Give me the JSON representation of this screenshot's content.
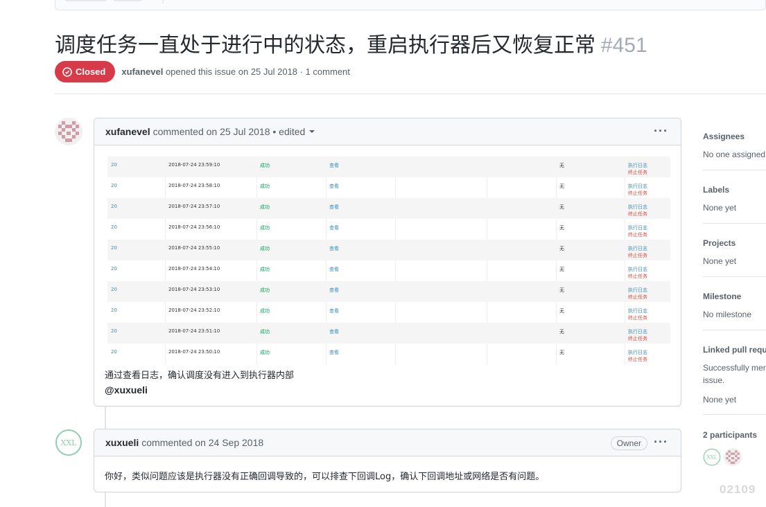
{
  "issue": {
    "title": "调度任务一直处于进行中的状态，重启执行器后又恢复正常",
    "number": "#451",
    "state": "Closed",
    "author": "xufanevel",
    "opened_text": "opened this issue on 25 Jul 2018 · 1 comment"
  },
  "comments": [
    {
      "author": "xufanevel",
      "meta": "commented on 25 Jul 2018 • edited",
      "more_icon": "kebab-horizontal-icon",
      "screenshot_rows": [
        {
          "id": "20",
          "time": "2018-07-24 23:59:10",
          "status": "成功",
          "view": "查看",
          "none": "无",
          "log": "执行日志",
          "stop": "终止任务"
        },
        {
          "id": "20",
          "time": "2018-07-24 23:58:10",
          "status": "成功",
          "view": "查看",
          "none": "无",
          "log": "执行日志",
          "stop": "终止任务"
        },
        {
          "id": "20",
          "time": "2018-07-24 23:57:10",
          "status": "成功",
          "view": "查看",
          "none": "无",
          "log": "执行日志",
          "stop": "终止任务"
        },
        {
          "id": "20",
          "time": "2018-07-24 23:56:10",
          "status": "成功",
          "view": "查看",
          "none": "无",
          "log": "执行日志",
          "stop": "终止任务"
        },
        {
          "id": "20",
          "time": "2018-07-24 23:55:10",
          "status": "成功",
          "view": "查看",
          "none": "无",
          "log": "执行日志",
          "stop": "终止任务"
        },
        {
          "id": "20",
          "time": "2018-07-24 23:54:10",
          "status": "成功",
          "view": "查看",
          "none": "无",
          "log": "执行日志",
          "stop": "终止任务"
        },
        {
          "id": "20",
          "time": "2018-07-24 23:53:10",
          "status": "成功",
          "view": "查看",
          "none": "无",
          "log": "执行日志",
          "stop": "终止任务"
        },
        {
          "id": "20",
          "time": "2018-07-24 23:52:10",
          "status": "成功",
          "view": "查看",
          "none": "无",
          "log": "执行日志",
          "stop": "终止任务"
        },
        {
          "id": "20",
          "time": "2018-07-24 23:51:10",
          "status": "成功",
          "view": "查看",
          "none": "无",
          "log": "执行日志",
          "stop": "终止任务"
        },
        {
          "id": "20",
          "time": "2018-07-24 23:50:10",
          "status": "成功",
          "view": "查看",
          "none": "无",
          "log": "执行日志",
          "stop": "终止任务"
        }
      ],
      "body": "通过查看日志，确认调度没有进入到执行器内部",
      "mention": "@xuxueli"
    },
    {
      "author": "xuxueli",
      "meta": "commented on 24 Sep 2018",
      "badge": "Owner",
      "more_icon": "kebab-horizontal-icon",
      "body": "你好，类似问题应该是执行器没有正确回调导致的，可以排查下回调Log，确认下回调地址或网络是否有问题。"
    }
  ],
  "sidebar": {
    "assignees": {
      "heading": "Assignees",
      "value": "No one assigned"
    },
    "labels": {
      "heading": "Labels",
      "value": "None yet"
    },
    "projects": {
      "heading": "Projects",
      "value": "None yet"
    },
    "milestone": {
      "heading": "Milestone",
      "value": "No milestone"
    },
    "linked": {
      "heading": "Linked pull reque",
      "value_line1": "Successfully merg",
      "value_line2": "issue.",
      "value_line3": "None yet"
    },
    "participants": {
      "heading": "2 participants"
    }
  },
  "avatar_text": "XXL",
  "watermark": "02109",
  "colors": {
    "closed": "#d73a49",
    "identicon": "#d29aa5",
    "xxl": "#8fcfb0"
  }
}
